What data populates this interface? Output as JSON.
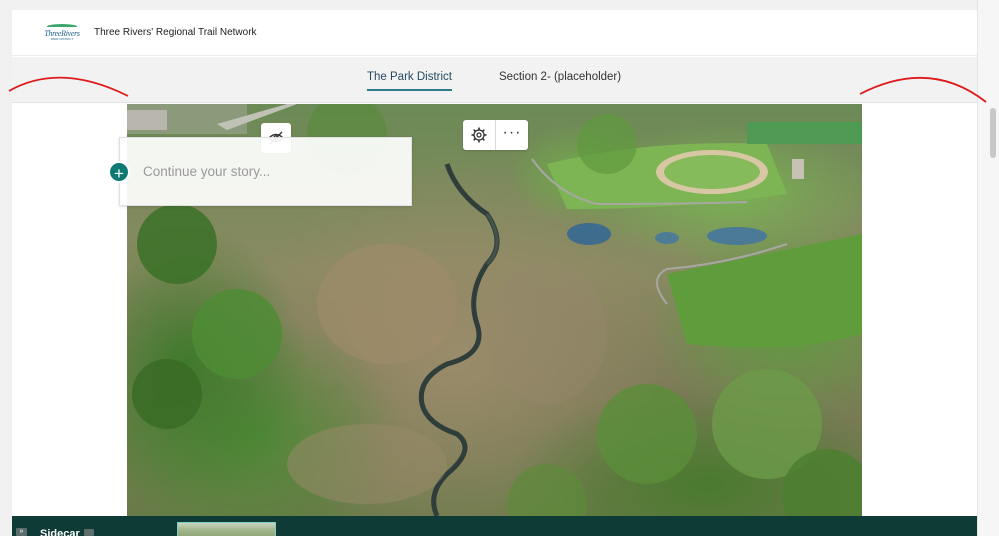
{
  "header": {
    "logo_text": "ThreeRivers",
    "logo_sub": "PARK DISTRICT",
    "site_title": "Three Rivers' Regional Trail Network"
  },
  "nav": {
    "tabs": [
      {
        "label": "The Park District",
        "active": true
      },
      {
        "label": "Section 2- (placeholder)",
        "active": false
      }
    ]
  },
  "story": {
    "placeholder": "Continue your story...",
    "add_icon": "plus-icon"
  },
  "toolbar": {
    "hide_icon": "eye-slash-icon",
    "settings_icon": "gear-icon",
    "more_icon": "more-dots-icon",
    "more_label": "···"
  },
  "bottom_bar": {
    "toggle": "»",
    "label": "Sidecar",
    "chip": "»"
  },
  "colors": {
    "accent": "#0e7a73",
    "nav_underline": "#2c7a8c",
    "bottom_bar": "#0f3b36",
    "annotation": "#e0191b"
  }
}
